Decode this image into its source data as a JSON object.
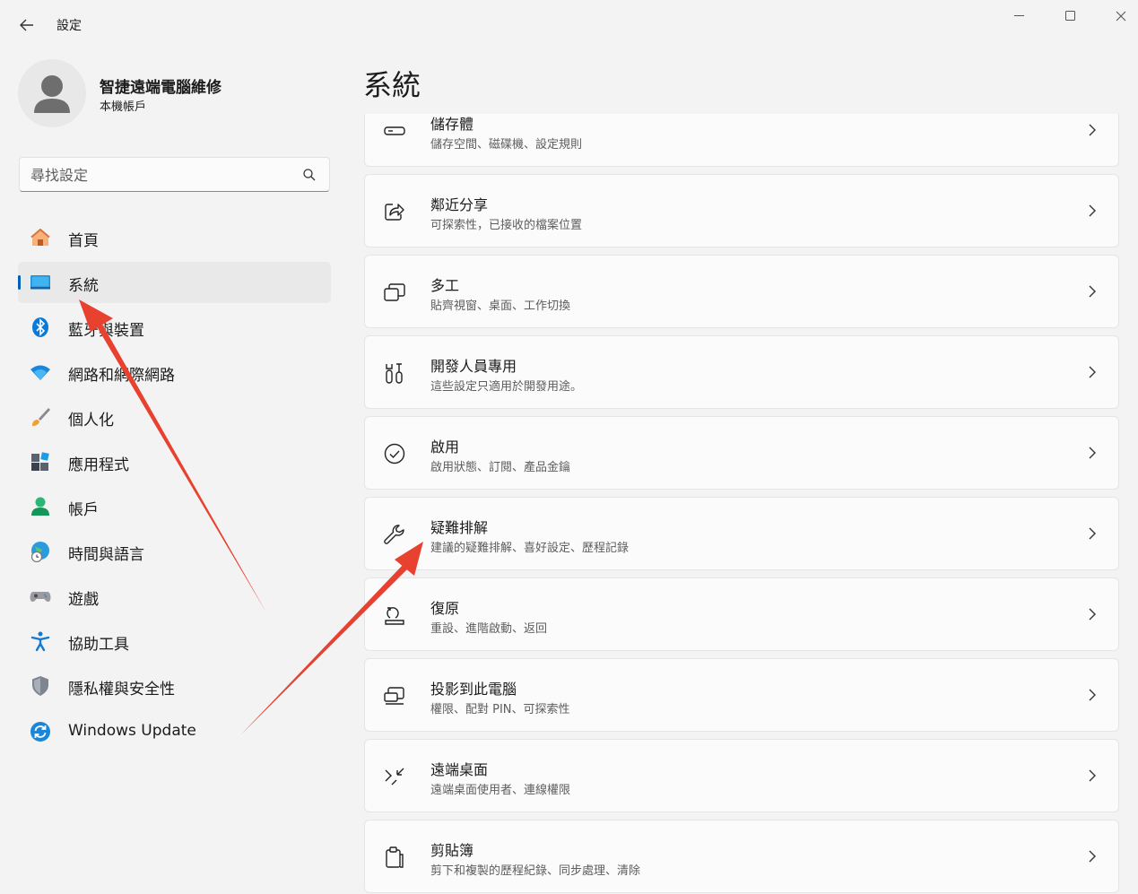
{
  "window": {
    "title": "設定"
  },
  "profile": {
    "name": "智捷遠端電腦維修",
    "account_type": "本機帳戶"
  },
  "search": {
    "placeholder": "尋找設定"
  },
  "sidebar": {
    "items": [
      {
        "label": "首頁",
        "icon": "home-icon"
      },
      {
        "label": "系統",
        "icon": "system-icon",
        "active": true
      },
      {
        "label": "藍牙與裝置",
        "icon": "bluetooth-icon"
      },
      {
        "label": "網路和網際網路",
        "icon": "wifi-icon"
      },
      {
        "label": "個人化",
        "icon": "brush-icon"
      },
      {
        "label": "應用程式",
        "icon": "apps-icon"
      },
      {
        "label": "帳戶",
        "icon": "account-icon"
      },
      {
        "label": "時間與語言",
        "icon": "globe-clock-icon"
      },
      {
        "label": "遊戲",
        "icon": "gamepad-icon"
      },
      {
        "label": "協助工具",
        "icon": "accessibility-icon"
      },
      {
        "label": "隱私權與安全性",
        "icon": "shield-icon"
      },
      {
        "label": "Windows Update",
        "icon": "update-icon"
      }
    ]
  },
  "main": {
    "title": "系統",
    "cards": [
      {
        "title": "儲存體",
        "desc": "儲存空間、磁碟機、設定規則",
        "icon": "storage-icon"
      },
      {
        "title": "鄰近分享",
        "desc": "可探索性，已接收的檔案位置",
        "icon": "share-icon"
      },
      {
        "title": "多工",
        "desc": "貼齊視窗、桌面、工作切換",
        "icon": "multitask-icon"
      },
      {
        "title": "開發人員專用",
        "desc": "這些設定只適用於開發用途。",
        "icon": "developer-tools-icon"
      },
      {
        "title": "啟用",
        "desc": "啟用狀態、訂閱、產品金鑰",
        "icon": "activation-check-icon"
      },
      {
        "title": "疑難排解",
        "desc": "建議的疑難排解、喜好設定、歷程記錄",
        "icon": "wrench-icon"
      },
      {
        "title": "復原",
        "desc": "重設、進階啟動、返回",
        "icon": "recovery-icon"
      },
      {
        "title": "投影到此電腦",
        "desc": "權限、配對 PIN、可探索性",
        "icon": "project-icon"
      },
      {
        "title": "遠端桌面",
        "desc": "遠端桌面使用者、連線權限",
        "icon": "remote-desktop-icon"
      },
      {
        "title": "剪貼簿",
        "desc": "剪下和複製的歷程紀錄、同步處理、清除",
        "icon": "clipboard-icon"
      }
    ]
  },
  "colors": {
    "accent": "#005fb8",
    "arrow": "#e8412f",
    "background": "#f3f3f3",
    "card": "#fbfbfb"
  }
}
